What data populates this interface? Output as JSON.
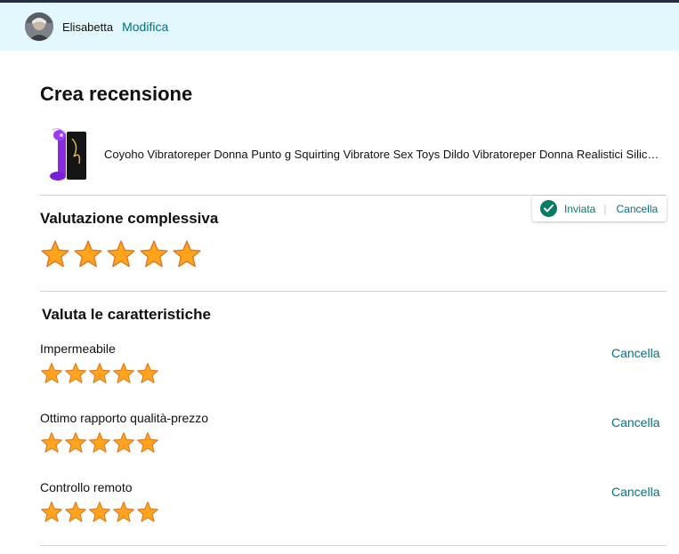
{
  "user": {
    "name": "Elisabetta",
    "edit_label": "Modifica"
  },
  "page": {
    "title": "Crea recensione"
  },
  "product": {
    "name": "Coyoho Vibratoreper Donna Punto g Squirting Vibratore Sex Toys Dildo Vibratoreper Donna Realistici Silicone Giocattoli del Sesso Donna Stimolatore Clitoride Vaginale Potente"
  },
  "status": {
    "icon": "check-circle-icon",
    "label": "Inviata",
    "separator": "|",
    "cancel_label": "Cancella"
  },
  "overall": {
    "title": "Valutazione complessiva",
    "rating": 5,
    "max": 5
  },
  "features": {
    "title": "Valuta le caratteristiche",
    "items": [
      {
        "label": "Impermeabile",
        "rating": 5,
        "max": 5,
        "cancel_label": "Cancella"
      },
      {
        "label": "Ottimo rapporto qualità-prezzo",
        "rating": 5,
        "max": 5,
        "cancel_label": "Cancella"
      },
      {
        "label": "Controllo remoto",
        "rating": 5,
        "max": 5,
        "cancel_label": "Cancella"
      }
    ]
  },
  "colors": {
    "accent_link": "#007185",
    "success": "#067d62",
    "user_bar_bg": "#e2f8fd",
    "star_fill": "#ffa41c",
    "star_stroke": "#de7921"
  }
}
